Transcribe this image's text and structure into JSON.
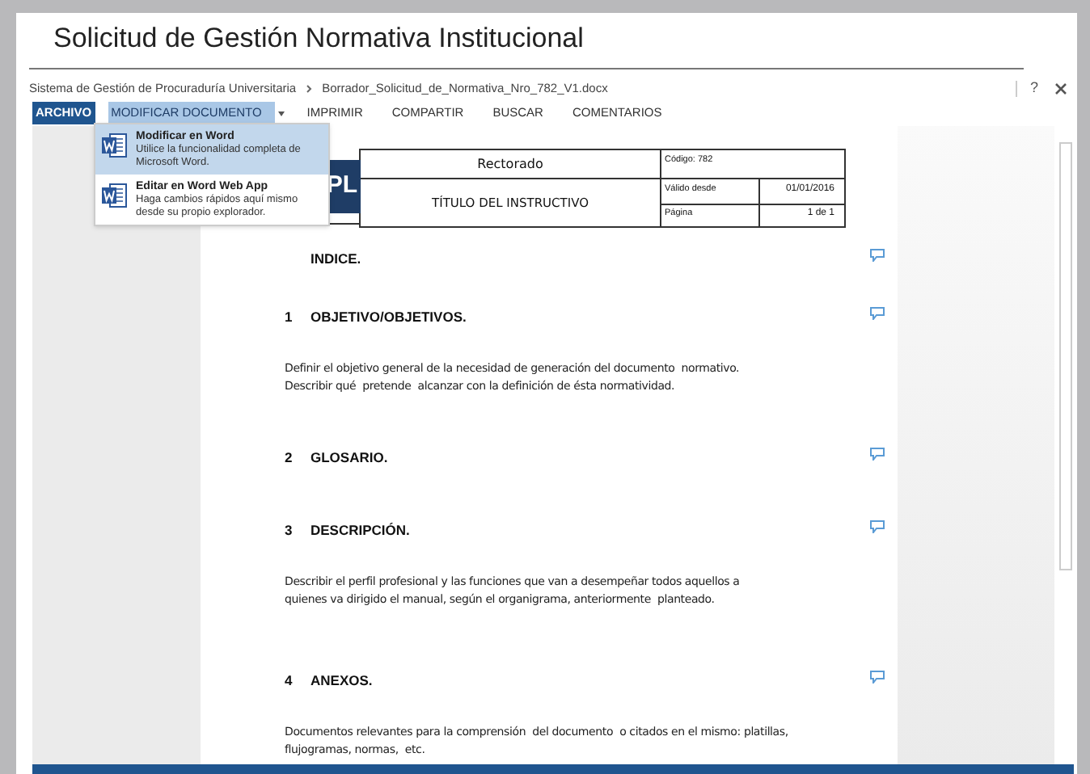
{
  "window": {
    "title": "Solicitud de Gestión Normativa Institucional"
  },
  "breadcrumb": [
    "Sistema de Gestión de Procuraduría Universitaria",
    "Borrador_Solicitud_de_Normativa_Nro_782_V1.docx"
  ],
  "menu": [
    {
      "label": "ARCHIVO",
      "kind": "file",
      "selected": false
    },
    {
      "label": "MODIFICAR DOCUMENTO",
      "kind": "dropdown",
      "selected": true
    },
    {
      "label": "IMPRIMIR",
      "kind": "plain",
      "selected": false
    },
    {
      "label": "COMPARTIR",
      "kind": "plain",
      "selected": false
    },
    {
      "label": "BUSCAR",
      "kind": "plain",
      "selected": false
    },
    {
      "label": "COMENTARIOS",
      "kind": "plain",
      "selected": false
    }
  ],
  "dropdown": [
    {
      "title": "Modificar en Word",
      "description": "Utilice la funcionalidad completa de Microsoft Word.",
      "selected": true
    },
    {
      "title": "Editar en Word Web App",
      "description": "Haga cambios rápidos aquí mismo desde su propio explorador.",
      "selected": false
    }
  ],
  "header_table": {
    "logo": "PL",
    "unit": "Rectorado",
    "doc_title": "TÍTULO DEL INSTRUCTIVO",
    "code": "Código: 782",
    "valid_label": "Válido desde",
    "valid_date": "01/01/2016",
    "page_label": "Página",
    "page_value": "1 de 1"
  },
  "help": "?",
  "sections": [
    {
      "kind": "heading",
      "title": "INDICE."
    },
    {
      "kind": "heading",
      "number": "1",
      "title": "OBJETIVO/OBJETIVOS."
    },
    {
      "kind": "paragraph",
      "lines": [
        "Definir el objetivo general de la necesidad de generación del documento  normativo.",
        "Describir qué  pretende  alcanzar con la definición de ésta normatividad."
      ]
    },
    {
      "kind": "heading",
      "number": "2",
      "title": "GLOSARIO."
    },
    {
      "kind": "heading",
      "number": "3",
      "title": "DESCRIPCIÓN."
    },
    {
      "kind": "paragraph",
      "lines": [
        "Describir el perfil profesional y las funciones que van a desempeñar todos aquellos a",
        "quienes va dirigido el manual, según el organigrama, anteriormente  planteado."
      ]
    },
    {
      "kind": "heading",
      "number": "4",
      "title": "ANEXOS."
    },
    {
      "kind": "paragraph",
      "lines": [
        "Documentos relevantes para la comprensión  del documento  o citados en el mismo: platillas,",
        "flujogramas, normas,  etc."
      ]
    }
  ]
}
